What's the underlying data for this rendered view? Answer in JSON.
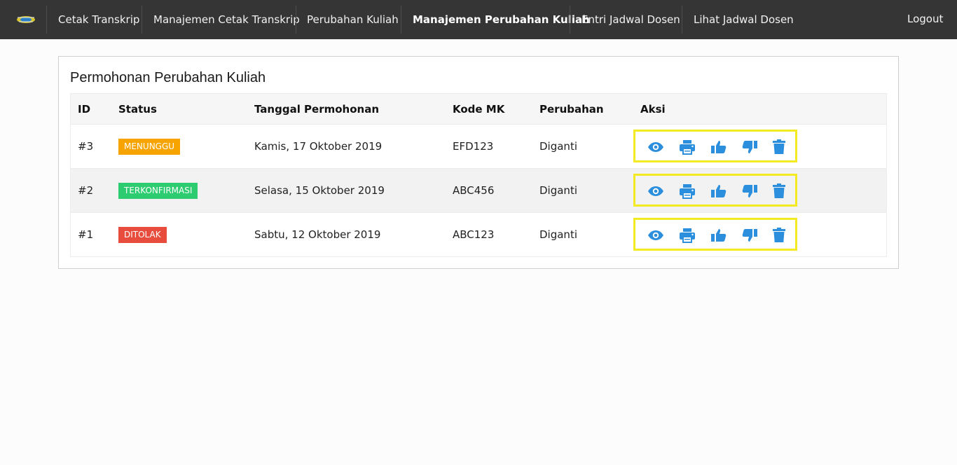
{
  "nav": {
    "items": [
      {
        "label": "Cetak Transkrip"
      },
      {
        "label": "Manajemen Cetak Transkrip"
      },
      {
        "label": "Perubahan Kuliah"
      },
      {
        "label": "Manajemen Perubahan Kuliah",
        "active": true
      },
      {
        "label": "Entri Jadwal Dosen"
      },
      {
        "label": "Lihat Jadwal Dosen"
      }
    ],
    "logout": "Logout"
  },
  "panel": {
    "title": "Permohonan Perubahan Kuliah"
  },
  "table": {
    "headers": [
      "ID",
      "Status",
      "Tanggal Permohonan",
      "Kode MK",
      "Perubahan",
      "Aksi"
    ],
    "rows": [
      {
        "id": "#3",
        "status": "MENUNGGU",
        "status_color": "#f7a400",
        "date": "Kamis, 17 Oktober 2019",
        "kode": "EFD123",
        "perubahan": "Diganti"
      },
      {
        "id": "#2",
        "status": "TERKONFIRMASI",
        "status_color": "#2ecc71",
        "date": "Selasa, 15 Oktober 2019",
        "kode": "ABC456",
        "perubahan": "Diganti"
      },
      {
        "id": "#1",
        "status": "DITOLAK",
        "status_color": "#e74c3c",
        "date": "Sabtu, 12 Oktober 2019",
        "kode": "ABC123",
        "perubahan": "Diganti"
      }
    ],
    "action_icons": [
      "eye-icon",
      "print-icon",
      "thumbs-up-icon",
      "thumbs-down-icon",
      "trash-icon"
    ],
    "action_color": "#2b8fde",
    "highlight_color": "#f3ea21"
  }
}
